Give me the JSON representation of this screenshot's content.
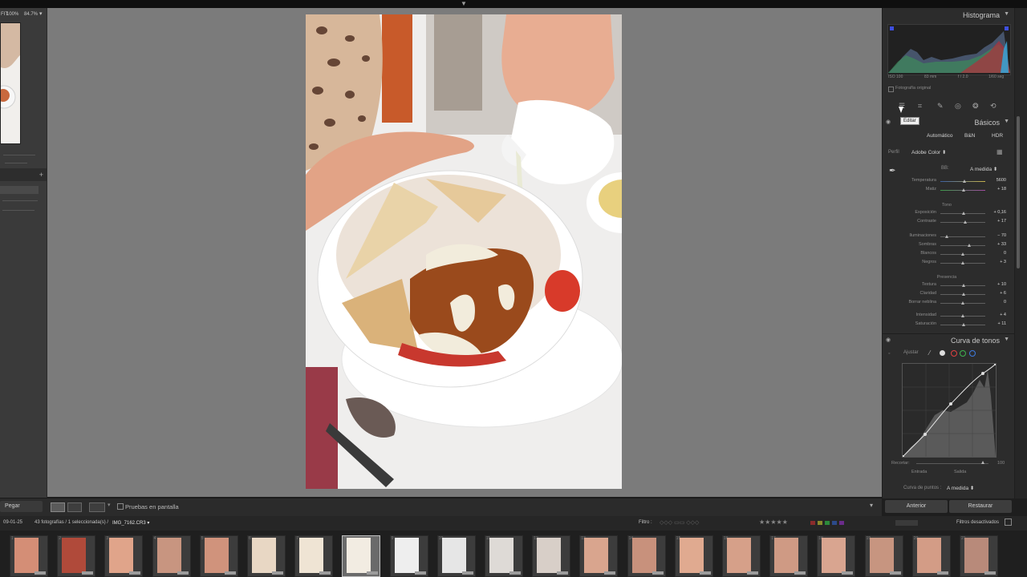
{
  "navigator": {
    "zoom_fit": "FIT",
    "zoom_a": "100%",
    "zoom_b": "84.7%"
  },
  "histogram": {
    "title": "Histograma",
    "iso": "ISO 100",
    "focal": "83 mm",
    "aperture": "f / 2.0",
    "shutter": "1/60 seg",
    "original_photo": "Fotografía original"
  },
  "tools": {
    "tooltip": "Editar"
  },
  "basics": {
    "title": "Básicos",
    "modes": [
      "Automático",
      "B&N",
      "HDR"
    ],
    "profile_label": "Perfil",
    "profile_value": "Adobe Color",
    "wb_label": "BB:",
    "wb_value": "A medida",
    "sliders_wb": [
      {
        "label": "Temperatura",
        "value": "5600",
        "pos": 0.55
      },
      {
        "label": "Matiz",
        "value": "+ 18",
        "pos": 0.53
      }
    ],
    "tone_header": "Tono",
    "sliders_tone_a": [
      {
        "label": "Exposición",
        "value": "+ 0,16",
        "pos": 0.52
      },
      {
        "label": "Contraste",
        "value": "+ 17",
        "pos": 0.56
      }
    ],
    "sliders_tone_b": [
      {
        "label": "Iluminaciones",
        "value": "− 70",
        "pos": 0.15
      },
      {
        "label": "Sombras",
        "value": "+ 33",
        "pos": 0.66
      },
      {
        "label": "Blancos",
        "value": "0",
        "pos": 0.5
      },
      {
        "label": "Negros",
        "value": "+ 3",
        "pos": 0.51
      }
    ],
    "presence_header": "Presencia",
    "sliders_presence_a": [
      {
        "label": "Textura",
        "value": "+ 10",
        "pos": 0.53
      },
      {
        "label": "Claridad",
        "value": "+ 6",
        "pos": 0.52
      },
      {
        "label": "Borrar neblina",
        "value": "0",
        "pos": 0.5
      }
    ],
    "sliders_presence_b": [
      {
        "label": "Intensidad",
        "value": "+ 4",
        "pos": 0.51
      },
      {
        "label": "Saturación",
        "value": "+ 11",
        "pos": 0.53
      }
    ]
  },
  "tone_curve": {
    "title": "Curva de tonos",
    "adjust_label": "Ajustar",
    "clip_label": "Recortar:",
    "clip_value": "100",
    "input_label": "Entrada",
    "output_label": "Salida",
    "point_curve_label": "Curva de puntos :",
    "point_curve_value": "A medida"
  },
  "right_buttons": {
    "previous": "Anterior",
    "reset": "Restaurar"
  },
  "center_toolbar": {
    "paste": "Pegar",
    "soft_proof": "Pruebas en pantalla"
  },
  "filmstrip": {
    "date": "09-01-25",
    "summary": "43 fotografías / 1 seleccionada(s) /",
    "filename": "IMG_7162.CR3",
    "filter_label": "Filtro :",
    "filters_off": "Filtros desactivados",
    "thumbnails": [
      {
        "num": "1"
      },
      {
        "num": "2"
      },
      {
        "num": "3"
      },
      {
        "num": "4"
      },
      {
        "num": "5"
      },
      {
        "num": "6"
      },
      {
        "num": "7"
      },
      {
        "num": "8"
      },
      {
        "num": "9"
      },
      {
        "num": "10"
      },
      {
        "num": "11"
      },
      {
        "num": "12"
      },
      {
        "num": "13"
      },
      {
        "num": "14"
      },
      {
        "num": "15"
      },
      {
        "num": "16"
      },
      {
        "num": "17"
      },
      {
        "num": "18"
      },
      {
        "num": "19"
      },
      {
        "num": "20"
      },
      {
        "num": "21"
      }
    ]
  },
  "colors": {
    "panel": "#2c2c2c",
    "canvas": "#7b7b7b",
    "accent_red": "#e04040",
    "accent_green": "#3fb44f",
    "accent_blue": "#3e7be0"
  }
}
